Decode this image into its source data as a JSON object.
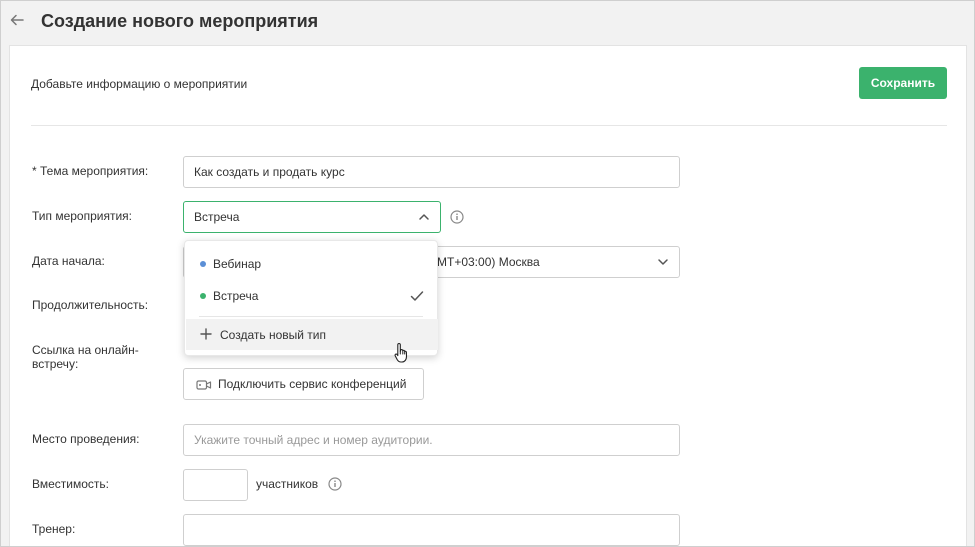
{
  "header": {
    "title": "Создание нового мероприятия"
  },
  "card": {
    "subtitle": "Добавьте информацию о мероприятии",
    "save_label": "Сохранить"
  },
  "form": {
    "topic": {
      "label": "* Тема мероприятия:",
      "value": "Как создать и продать курс"
    },
    "type": {
      "label": "Тип мероприятия:",
      "value": "Встреча"
    },
    "start_date": {
      "label": "Дата начала:",
      "timezone_value": "MT+03:00) Москва"
    },
    "duration": {
      "label": "Продолжительность:"
    },
    "online_link": {
      "label_line1": "Ссылка на онлайн-",
      "label_line2": "встречу:",
      "connect_label": "Подключить сервис конференций"
    },
    "location": {
      "label": "Место проведения:",
      "placeholder": "Укажите точный адрес и номер аудитории."
    },
    "capacity": {
      "label": "Вместимость:",
      "value": "",
      "unit": "участников"
    },
    "trainer": {
      "label": "Тренер:",
      "value": ""
    }
  },
  "dropdown": {
    "items": [
      {
        "label": "Вебинар",
        "dot_color": "#5b8fd6",
        "selected": false
      },
      {
        "label": "Встреча",
        "dot_color": "#3bb26d",
        "selected": true
      }
    ],
    "create_label": "Создать новый тип"
  },
  "colors": {
    "accent": "#3bb26d",
    "border": "#cfcfcf",
    "text": "#333333"
  }
}
